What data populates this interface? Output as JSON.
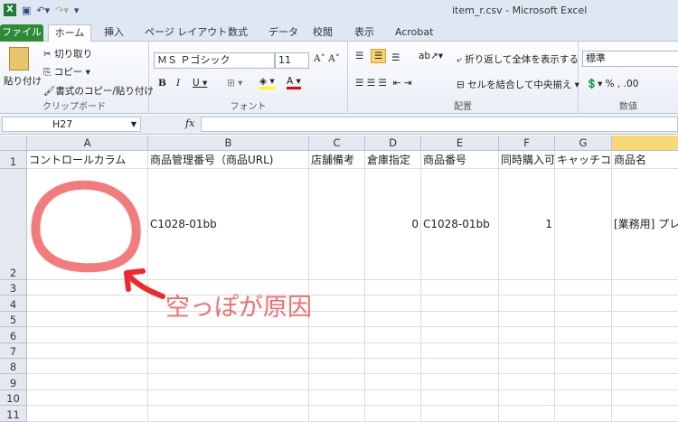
{
  "window": {
    "title": "item_r.csv - Microsoft Excel"
  },
  "tabs": [
    "ファイル",
    "ホーム",
    "挿入",
    "ページ レイアウト",
    "数式",
    "データ",
    "校閲",
    "表示",
    "Acrobat"
  ],
  "ribbon": {
    "clipboard": {
      "paste": "貼り付け",
      "cut": "切り取り",
      "copy": "コピー ▾",
      "format_painter": "書式のコピー/貼り付け",
      "label": "クリップボード"
    },
    "font": {
      "name": "ＭＳ Ｐゴシック",
      "size": "11",
      "label": "フォント"
    },
    "alignment": {
      "wrap": "折り返して全体を表示する",
      "merge": "セルを結合して中央揃え ▾",
      "label": "配置"
    },
    "number": {
      "format": "標準",
      "label": "数値"
    }
  },
  "formula_bar": {
    "name_box": "H27",
    "fx": "fx",
    "value": ""
  },
  "sheet": {
    "columns": [
      "A",
      "B",
      "C",
      "D",
      "E",
      "F",
      "G",
      ""
    ],
    "rows": [
      "1",
      "2",
      "3",
      "4",
      "5",
      "6",
      "7",
      "8",
      "9",
      "10",
      "11"
    ],
    "row1": [
      "コントロールカラム",
      "商品管理番号（商品URL)",
      "店舗備考",
      "倉庫指定",
      "商品番号",
      "同時購入可",
      "キャッチコ",
      "商品名"
    ],
    "row2": [
      "",
      "C1028-01bb",
      "",
      "0",
      "C1028-01bb",
      "1",
      "",
      "[業務用] プレ"
    ]
  },
  "annotation": {
    "text": "空っぽが原因",
    "color": "#f46b6e"
  }
}
